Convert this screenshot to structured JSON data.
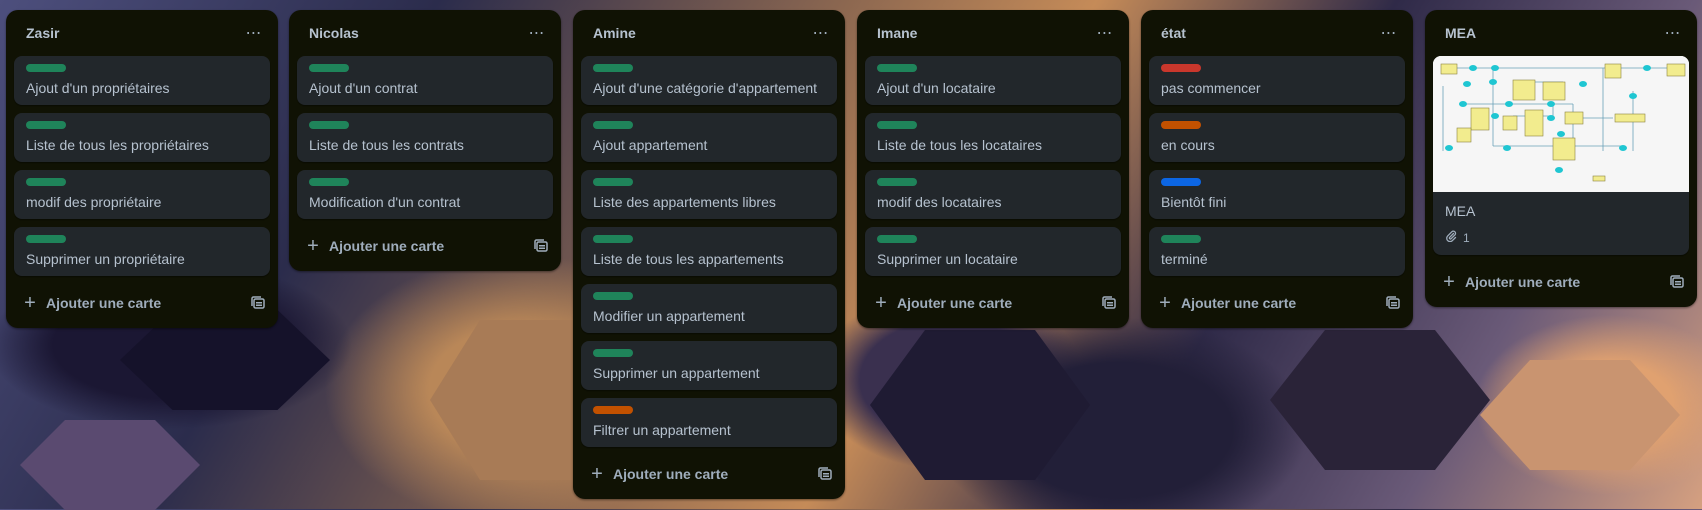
{
  "colors": {
    "green": "#1f845a",
    "red": "#c9372c",
    "orange": "#c25100",
    "blue": "#0c66e4"
  },
  "add_card_label": "Ajouter une carte",
  "menu_icon": "ellipsis-icon",
  "lists": [
    {
      "title": "Zasir",
      "cards": [
        {
          "label": "green",
          "text": "Ajout d'un propriétaires"
        },
        {
          "label": "green",
          "text": "Liste de tous les propriétaires"
        },
        {
          "label": "green",
          "text": "modif des propriétaire"
        },
        {
          "label": "green",
          "text": "Supprimer un propriétaire"
        }
      ]
    },
    {
      "title": "Nicolas",
      "cards": [
        {
          "label": "green",
          "text": "Ajout d'un contrat"
        },
        {
          "label": "green",
          "text": "Liste de tous les contrats"
        },
        {
          "label": "green",
          "text": "Modification d'un contrat"
        }
      ]
    },
    {
      "title": "Amine",
      "cards": [
        {
          "label": "green",
          "text": "Ajout d'une catégorie d'appartement"
        },
        {
          "label": "green",
          "text": "Ajout appartement"
        },
        {
          "label": "green",
          "text": "Liste des appartements libres"
        },
        {
          "label": "green",
          "text": "Liste de tous les appartements"
        },
        {
          "label": "green",
          "text": "Modifier un appartement"
        },
        {
          "label": "green",
          "text": "Supprimer un appartement"
        },
        {
          "label": "orange",
          "text": "Filtrer un appartement"
        }
      ]
    },
    {
      "title": "Imane",
      "cards": [
        {
          "label": "green",
          "text": "Ajout d'un locataire"
        },
        {
          "label": "green",
          "text": "Liste de tous les locataires"
        },
        {
          "label": "green",
          "text": "modif des locataires"
        },
        {
          "label": "green",
          "text": "Supprimer un locataire"
        }
      ]
    },
    {
      "title": "état",
      "cards": [
        {
          "label": "red",
          "text": "pas commencer"
        },
        {
          "label": "orange",
          "text": "en cours"
        },
        {
          "label": "blue",
          "text": "Bientôt fini"
        },
        {
          "label": "green",
          "text": "terminé"
        }
      ]
    },
    {
      "title": "MEA",
      "cover_card": {
        "text": "MEA",
        "attachments": "1",
        "icon": "paperclip-icon"
      }
    }
  ]
}
